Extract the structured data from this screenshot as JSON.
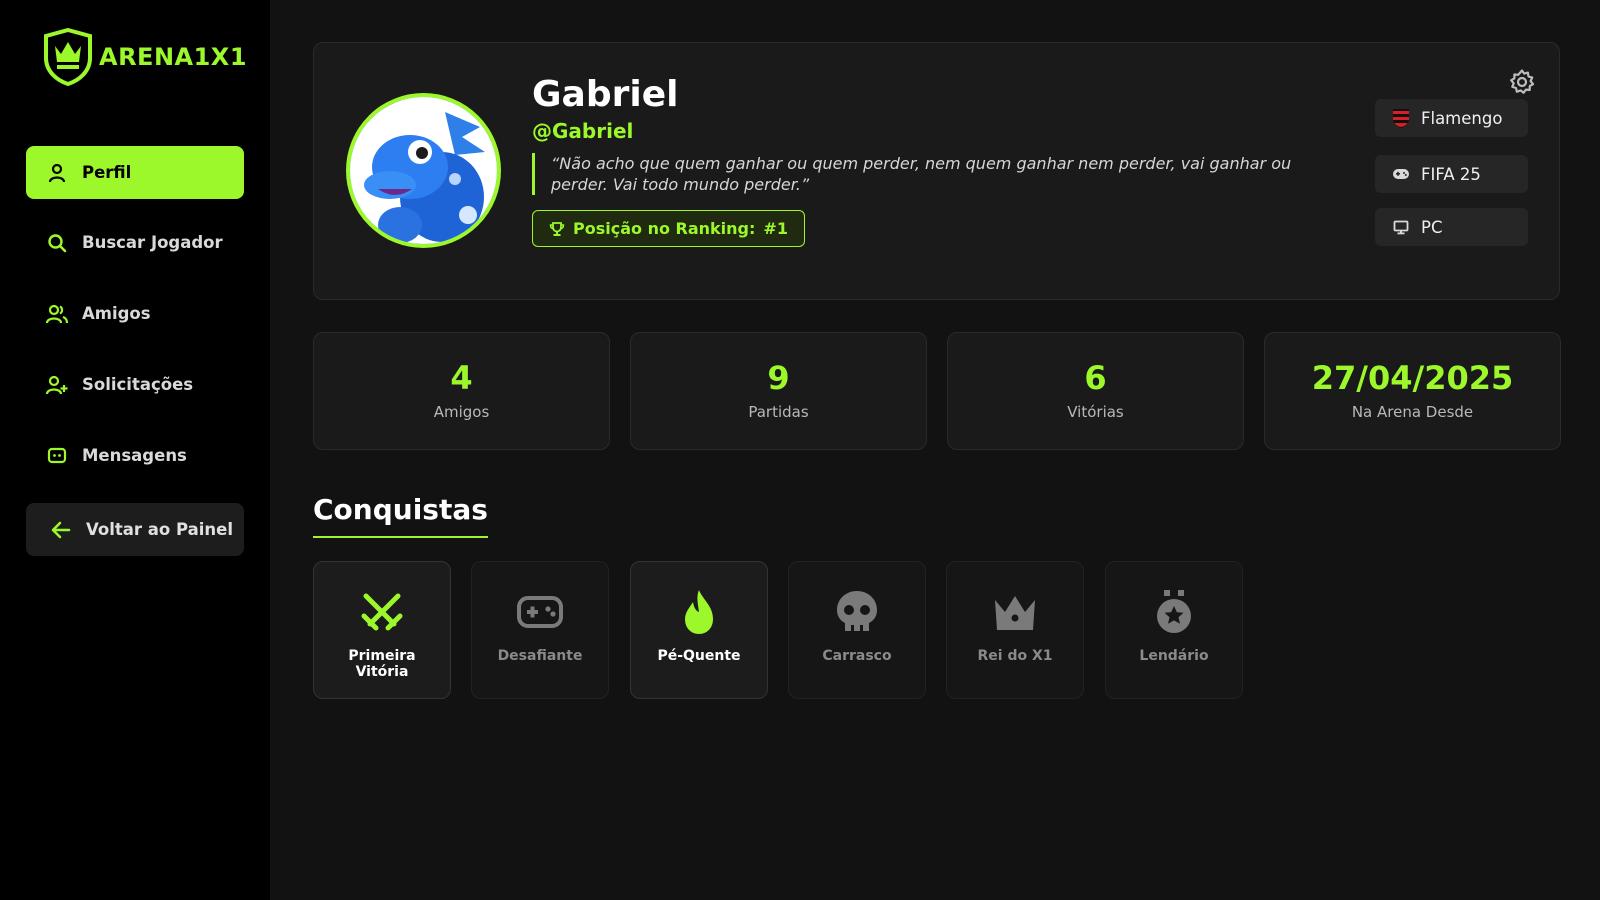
{
  "app": {
    "name": "ARENA1X1"
  },
  "sidebar": {
    "items": [
      {
        "label": "Perfil",
        "icon": "user-icon",
        "active": true
      },
      {
        "label": "Buscar Jogador",
        "icon": "search-icon",
        "active": false
      },
      {
        "label": "Amigos",
        "icon": "friends-icon",
        "active": false
      },
      {
        "label": "Solicitações",
        "icon": "add-user-icon",
        "active": false
      },
      {
        "label": "Mensagens",
        "icon": "message-icon",
        "active": false
      }
    ],
    "back_label": "Voltar ao Painel"
  },
  "profile": {
    "name": "Gabriel",
    "handle": "@Gabriel",
    "quote": "“Não acho que quem ganhar ou quem perder, nem quem ganhar nem perder, vai ganhar ou perder. Vai todo mundo perder.”",
    "rank_label": "Posição no Ranking:",
    "rank_value": "#1",
    "team": "Flamengo",
    "game": "FIFA 25",
    "platform": "PC"
  },
  "stats": [
    {
      "value": "4",
      "label": "Amigos"
    },
    {
      "value": "9",
      "label": "Partidas"
    },
    {
      "value": "6",
      "label": "Vitórias"
    },
    {
      "value": "27/04/2025",
      "label": "Na Arena Desde"
    }
  ],
  "achievements": {
    "title": "Conquistas",
    "items": [
      {
        "label": "Primeira Vitória",
        "icon": "crossed-swords-icon",
        "unlocked": true
      },
      {
        "label": "Desafiante",
        "icon": "gamepad-icon",
        "unlocked": false
      },
      {
        "label": "Pé-Quente",
        "icon": "flame-icon",
        "unlocked": true
      },
      {
        "label": "Carrasco",
        "icon": "skull-icon",
        "unlocked": false
      },
      {
        "label": "Rei do X1",
        "icon": "crown-icon",
        "unlocked": false
      },
      {
        "label": "Lendário",
        "icon": "medal-icon",
        "unlocked": false
      }
    ]
  },
  "colors": {
    "accent": "#9CF82B",
    "background": "#121212",
    "sidebar": "#000000",
    "card": "#1a1a1a"
  }
}
